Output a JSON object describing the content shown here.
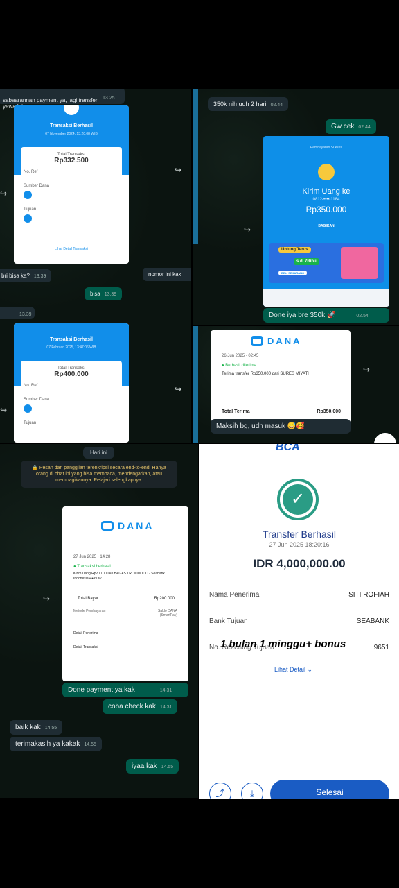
{
  "p1": {
    "top_msg": "sabaarannan payment ya, lagi transfer\nyewa lain",
    "top_time": "13.25",
    "card1": {
      "title": "Transaksi Berhasil",
      "date": "07 November 2024, 13:20:08 WIB",
      "total_label": "Total Transaksi",
      "amount": "Rp332.500",
      "no_ref": "No. Ref",
      "sumber": "Sumber Dana",
      "tujuan": "Tujuan",
      "lihat": "Lihat Detail Transaksi"
    },
    "msg_bri": "bri bisa ka?",
    "msg_bri_time": "13.39",
    "msg_nomor": "nomor ini kak",
    "msg_bisa": "bisa",
    "msg_bisa_time": "13.39",
    "msg_empty_time": "13.39",
    "card2": {
      "title": "Transaksi Berhasil",
      "date": "07 Februari 2025, 13:47:06 WIB",
      "total_label": "Total Transaksi",
      "amount": "Rp400.000",
      "no_ref": "No. Ref",
      "sumber": "Sumber Dana",
      "tujuan": "Tujuan"
    }
  },
  "p2": {
    "msg1": "350k nih udh 2 hari",
    "msg1_time": "02.44",
    "msg2": "Gw cek",
    "msg2_time": "02.44",
    "card": {
      "top": "Pembayaran Sukses",
      "kirim": "Kirim Uang ke",
      "phone": "0812-••••-1184",
      "amount": "Rp350.000",
      "bagikan": "BAGIKAN",
      "promo": "Untung Terus",
      "promo2": "s.d. 7Ribu",
      "beli": "BELI SEKARANG"
    },
    "msg3": "Done iya bre 350k",
    "msg3_time": "02.54"
  },
  "p3": {
    "logo": "DANA",
    "date": "26 Jun 2025 · 02:45",
    "status": "Berhasil diterima",
    "desc": "Terima transfer Rp350.000 dari SURES MIYATI",
    "total_label": "Total Terima",
    "total_value": "Rp350.000",
    "msg": "Maksih bg, udh masuk"
  },
  "p4": {
    "day": "Hari ini",
    "notice": "Pesan dan panggilan terenkripsi secara end-to-end. Hanya orang di chat ini yang bisa membaca, mendengarkan, atau membagikannya. Pelajari selengkapnya.",
    "card": {
      "logo": "DANA",
      "date": "27 Jun 2025 · 14:28",
      "status": "Transaksi berhasil",
      "desc": "Kirim Uang Rp200.000 ke BAGAS TRI WIDODO - Seabank Indonesia ••••6067",
      "total_label": "Total Bayar",
      "total_value": "Rp200.000",
      "metode_label": "Metode Pembayaran",
      "metode_value": "Saldo DANA (SmartPay)",
      "detail_penerima": "Detail Penerima",
      "detail_transaksi": "Detail Transaksi"
    },
    "msg_done": "Done payment ya kak",
    "msg_done_time": "14.31",
    "msg_coba": "coba check kak",
    "msg_coba_time": "14.31",
    "msg_baik": "baik kak",
    "msg_baik_time": "14.55",
    "msg_terima": "terimakasih ya kakak",
    "msg_terima_time": "14.55",
    "msg_iyaa": "iyaa kak",
    "msg_iyaa_time": "14.55"
  },
  "p5": {
    "logo": "BCA",
    "title": "Transfer Berhasil",
    "date": "27 Jun 2025 18:20:16",
    "amount": "IDR 4,000,000.00",
    "nama_label": "Nama Penerima",
    "nama_value": "SITI ROFIAH",
    "bank_label": "Bank Tujuan",
    "bank_value": "SEABANK",
    "norek_label": "No. Rekening Tujuan",
    "norek_value": "9651",
    "overlay": "1 bulan 1 minggu+ bonus",
    "lihat": "Lihat Detail",
    "selesai": "Selesai"
  }
}
